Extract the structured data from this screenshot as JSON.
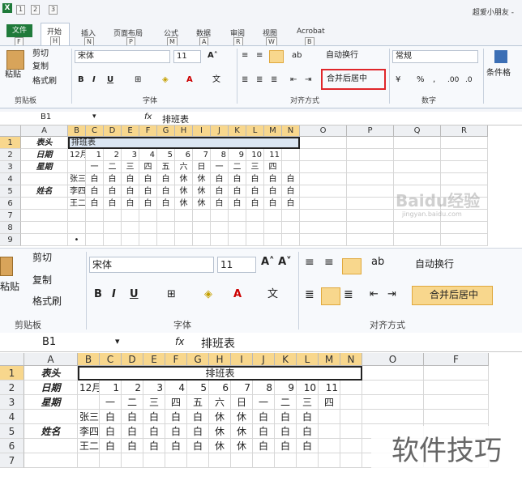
{
  "top": {
    "title_right": "超爱小朋友 -",
    "quick_access_keys": [
      "1",
      "2",
      "3"
    ],
    "tabs": [
      {
        "label": "文件",
        "key": "F",
        "active": false,
        "green": true
      },
      {
        "label": "开始",
        "key": "H",
        "active": true
      },
      {
        "label": "插入",
        "key": "N"
      },
      {
        "label": "页面布局",
        "key": "P"
      },
      {
        "label": "公式",
        "key": "M"
      },
      {
        "label": "数据",
        "key": "A"
      },
      {
        "label": "审阅",
        "key": "R"
      },
      {
        "label": "视图",
        "key": "W"
      },
      {
        "label": "Acrobat",
        "key": "B"
      }
    ],
    "clipboard": {
      "paste": "粘贴",
      "cut": "剪切",
      "copy": "复制",
      "format_painter": "格式刷",
      "group": "剪贴板"
    },
    "font": {
      "name": "宋体",
      "size": "11",
      "group": "字体",
      "bold": "B",
      "italic": "I",
      "underline": "U"
    },
    "align": {
      "wrap": "自动换行",
      "merge": "合并后居中",
      "group": "对齐方式"
    },
    "number": {
      "format": "常规",
      "percent": "%",
      "comma": ",",
      "inc": ".00",
      "dec": ".0",
      "group": "数字"
    },
    "styles": {
      "cond": "条件格"
    },
    "formula": {
      "cell_ref": "B1",
      "fx": "fx",
      "value": "排班表"
    },
    "columns": [
      "A",
      "B",
      "C",
      "D",
      "E",
      "F",
      "G",
      "H",
      "I",
      "J",
      "K",
      "L",
      "M",
      "N",
      "O",
      "P",
      "Q",
      "R"
    ],
    "rows": [
      "1",
      "2",
      "3",
      "4",
      "5",
      "6",
      "7",
      "8",
      "9"
    ],
    "sheet": {
      "r1": {
        "a": "表头",
        "b": "排班表"
      },
      "r2": {
        "a": "日期",
        "b": "12月",
        "days": [
          "1",
          "2",
          "3",
          "4",
          "5",
          "6",
          "7",
          "8",
          "9",
          "10",
          "11"
        ]
      },
      "r3": {
        "a": "星期",
        "week": [
          "一",
          "二",
          "三",
          "四",
          "五",
          "六",
          "日",
          "一",
          "二",
          "三",
          "四"
        ]
      },
      "names": [
        "张三",
        "李四",
        "王二麻子"
      ],
      "name_label": "姓名",
      "shifts": [
        [
          "白",
          "白",
          "白",
          "白",
          "白",
          "休",
          "休",
          "白",
          "白",
          "白",
          "白",
          "白"
        ],
        [
          "白",
          "白",
          "白",
          "白",
          "白",
          "休",
          "休",
          "白",
          "白",
          "白",
          "白",
          "白"
        ],
        [
          "白",
          "白",
          "白",
          "白",
          "白",
          "休",
          "休",
          "白",
          "白",
          "白",
          "白",
          "白"
        ]
      ],
      "marker": "•"
    },
    "watermark": "Baidu经验",
    "watermark_sub": "jingyan.baidu.com"
  },
  "bottom": {
    "clipboard": {
      "cut": "剪切",
      "copy": "复制",
      "format_painter": "格式刷",
      "paste": "粘贴",
      "group": "剪贴板"
    },
    "font": {
      "name": "宋体",
      "size": "11",
      "group": "字体"
    },
    "align": {
      "wrap": "自动换行",
      "merge": "合并后居中",
      "group": "对齐方式"
    },
    "formula": {
      "cell_ref": "B1",
      "fx": "fx",
      "value": "排班表"
    },
    "columns": [
      "A",
      "B",
      "C",
      "D",
      "E",
      "F",
      "G",
      "H",
      "I",
      "J",
      "K",
      "L",
      "M",
      "N",
      "O",
      "F"
    ],
    "rows": [
      "1",
      "2",
      "3",
      "4",
      "5",
      "6",
      "7"
    ],
    "sheet": {
      "r1": {
        "a": "表头",
        "b": "排班表"
      },
      "r2": {
        "a": "日期",
        "b": "12月",
        "days": [
          "1",
          "2",
          "3",
          "4",
          "5",
          "6",
          "7",
          "8",
          "9",
          "10",
          "11"
        ]
      },
      "r3": {
        "a": "星期",
        "week": [
          "一",
          "二",
          "三",
          "四",
          "五",
          "六",
          "日",
          "一",
          "二",
          "三",
          "四"
        ]
      },
      "names": [
        "张三",
        "李四",
        "王二麻子"
      ],
      "name_label": "姓名",
      "shifts": [
        [
          "白",
          "白",
          "白",
          "白",
          "白",
          "休",
          "休",
          "白",
          "白",
          "白"
        ],
        [
          "白",
          "白",
          "白",
          "白",
          "白",
          "休",
          "休",
          "白",
          "白",
          "白"
        ],
        [
          "白",
          "白",
          "白",
          "白",
          "白",
          "休",
          "休",
          "白",
          "白",
          "白"
        ]
      ]
    },
    "watermark": "软件技巧"
  },
  "colors": {
    "highlight": "#f8d78d",
    "merge_box": "#e0262a",
    "excel_green": "#1f7a3a"
  }
}
